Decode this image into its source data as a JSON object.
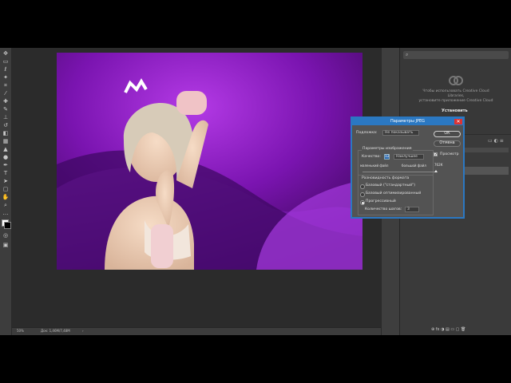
{
  "status": {
    "zoom": "50%",
    "doc": "Док: 1,46М/7,48М"
  },
  "cc_panel": {
    "search_placeholder": "",
    "line1": "Чтобы использовать Creative Cloud",
    "line2": "Libraries,",
    "line3": "установите приложение Creative Cloud",
    "install": "Установить"
  },
  "dialog": {
    "title": "Параметры JPEG",
    "matte_label": "Подложка:",
    "matte_value": "Не показывать",
    "image_options": "Параметры изображения",
    "quality_label": "Качество:",
    "quality_value": "12",
    "quality_preset": "Наилучшее",
    "small_file": "маленький файл",
    "large_file": "большой файл",
    "format_options": "Разновидность формата",
    "opt1": "Базовый (\"стандартный\")",
    "opt2": "Базовый оптимизированный",
    "opt3": "Прогрессивный",
    "scans_label": "Количество шагов:",
    "scans_value": "3",
    "ok": "ОК",
    "cancel": "Отмена",
    "preview": "Просмотр",
    "size": "762К",
    "quality_fraction": 1.0
  },
  "colors": {
    "accent": "#2b78c2",
    "canvas_bg": "#8a1fc0"
  }
}
